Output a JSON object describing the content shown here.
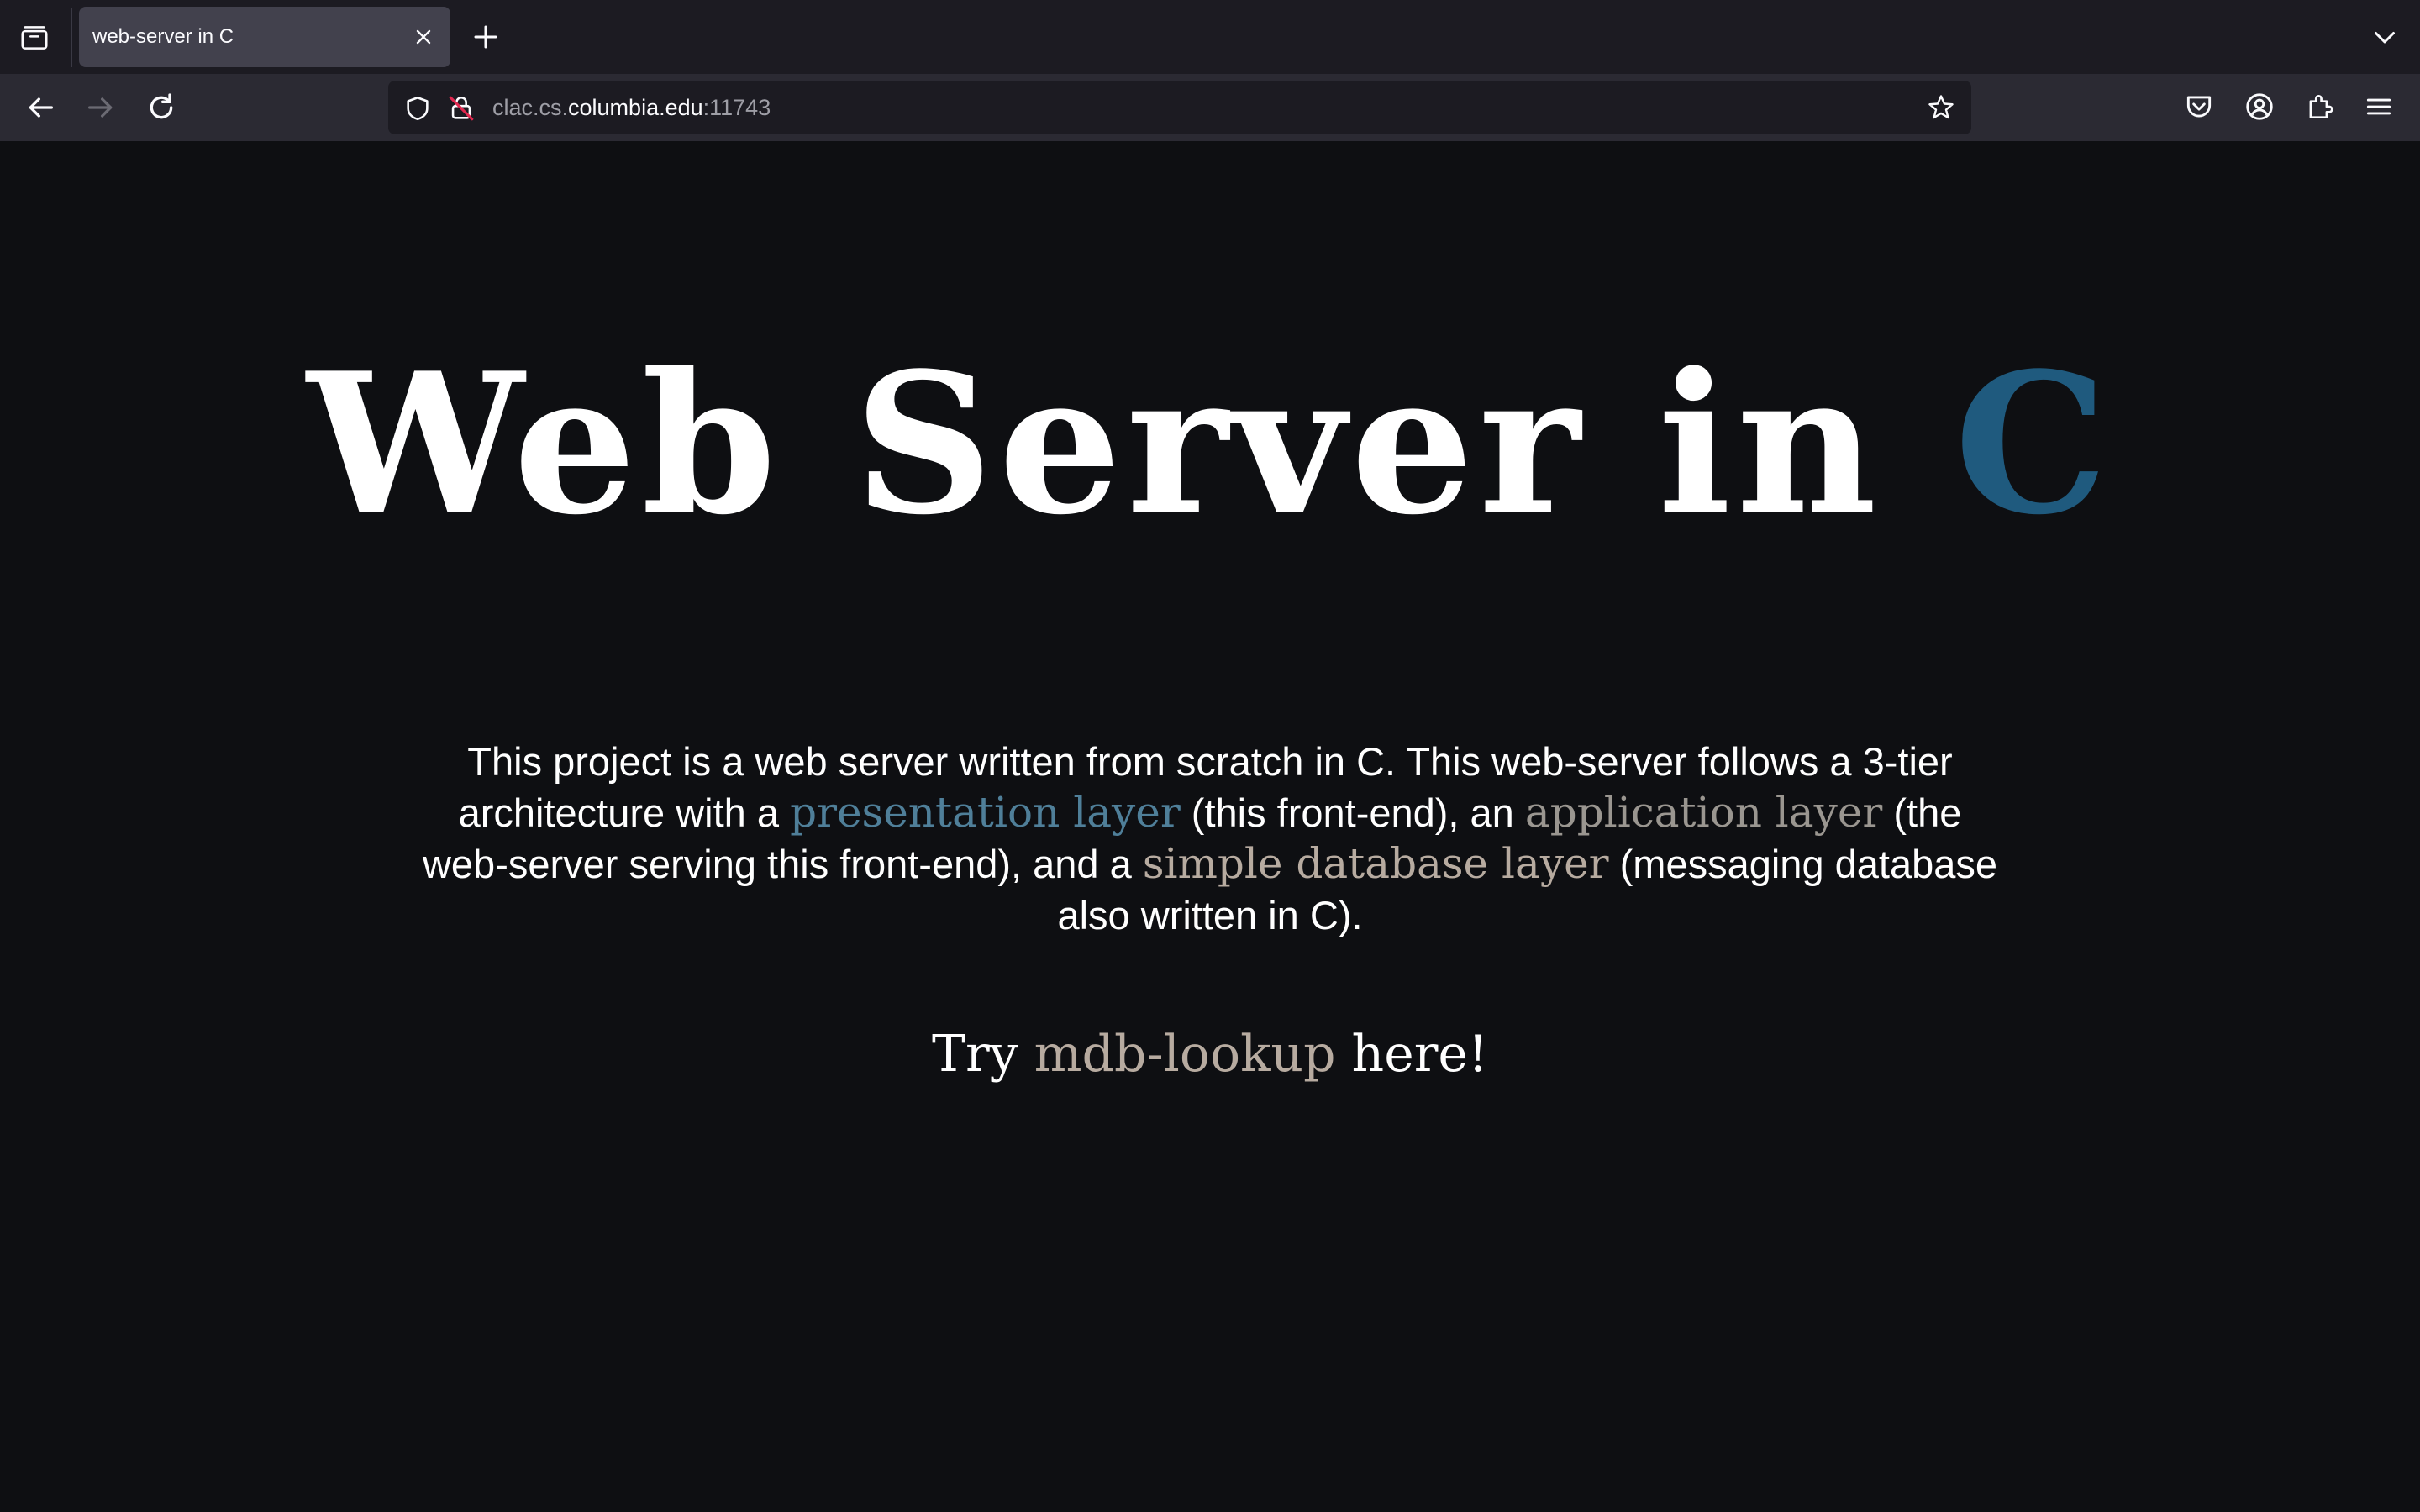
{
  "browser": {
    "tab": {
      "title": "web-server in C"
    },
    "url": {
      "prefix": "clac.cs.",
      "host": "columbia.edu",
      "port": ":11743"
    }
  },
  "page": {
    "title_main": "Web Server in ",
    "title_accent": "C",
    "description": {
      "part1": "This project is a web server written from scratch in C. This web-server follows a 3-tier architecture with a ",
      "link_presentation": "presentation layer",
      "part2": " (this front-end), an ",
      "link_application": "application layer",
      "part3": " (the web-server serving this front-end), and a ",
      "link_database": "simple database layer",
      "part4": " (messaging database also written in C)."
    },
    "try_prefix": "Try ",
    "try_link": "mdb-lookup",
    "try_suffix": " here!"
  },
  "colors": {
    "background": "#0e0f12",
    "accent_blue": "#1f5a7e",
    "link_presentation": "#4f7f99",
    "link_application": "#9a9690",
    "link_database": "#b7aba0"
  },
  "icons": {
    "tab_list": "tab-list-icon",
    "close": "close-icon",
    "new_tab": "plus-icon",
    "overflow": "chevron-down-icon",
    "back": "back-arrow-icon",
    "forward": "forward-arrow-icon",
    "reload": "reload-icon",
    "shield": "shield-icon",
    "lock": "insecure-lock-icon",
    "bookmark": "star-icon",
    "pocket": "pocket-icon",
    "account": "account-icon",
    "extensions": "puzzle-icon",
    "menu": "hamburger-menu-icon"
  }
}
